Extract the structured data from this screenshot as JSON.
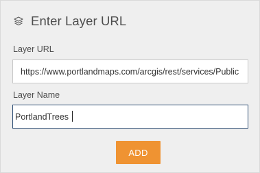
{
  "header": {
    "icon": "layers-icon",
    "title": "Enter Layer URL"
  },
  "fields": {
    "layer_url": {
      "label": "Layer URL",
      "value": "https://www.portlandmaps.com/arcgis/rest/services/Public"
    },
    "layer_name": {
      "label": "Layer Name",
      "value": "PortlandTrees"
    }
  },
  "actions": {
    "add_label": "ADD"
  },
  "colors": {
    "panel_background": "#efefef",
    "accent": "#ef9332",
    "focus_border": "#2f4f75"
  }
}
